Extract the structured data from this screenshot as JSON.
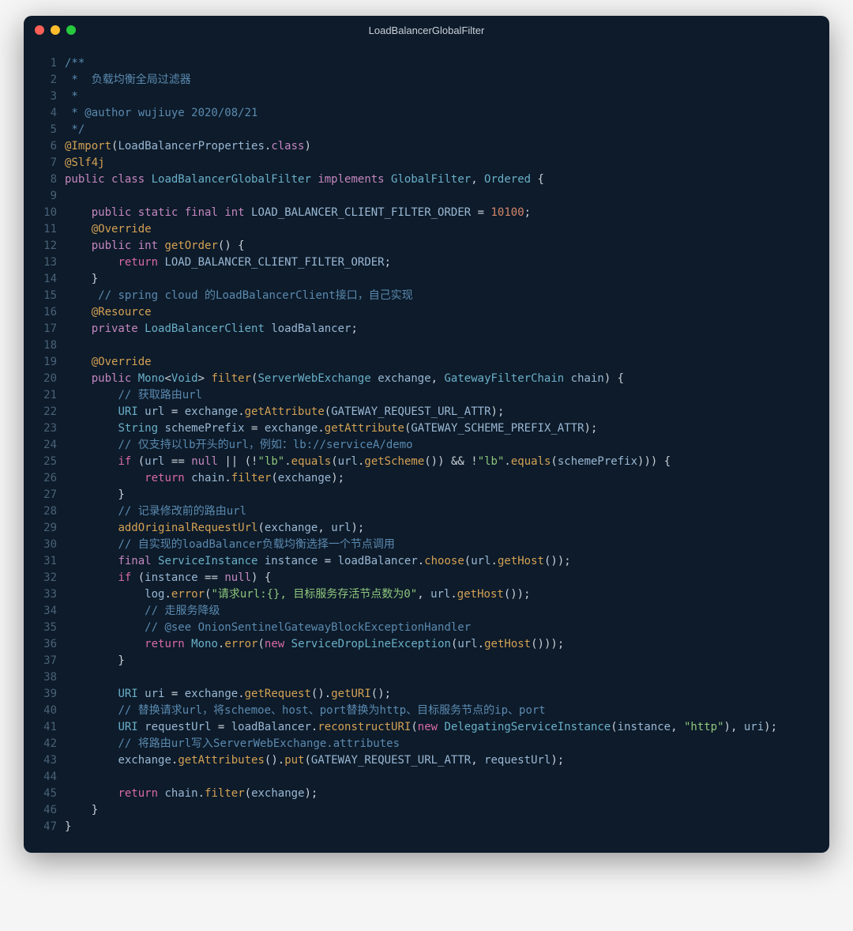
{
  "window": {
    "title": "LoadBalancerGlobalFilter"
  },
  "traffic_lights": [
    "red",
    "yellow",
    "green"
  ],
  "code": {
    "lines": [
      [
        [
          "cm",
          "/**"
        ]
      ],
      [
        [
          "cm",
          " *  负载均衡全局过滤器"
        ]
      ],
      [
        [
          "cm",
          " *"
        ]
      ],
      [
        [
          "cm",
          " * @author wujiuye 2020/08/21"
        ]
      ],
      [
        [
          "cm",
          " */"
        ]
      ],
      [
        [
          "an",
          "@Import"
        ],
        [
          "op",
          "("
        ],
        [
          "id",
          "LoadBalancerProperties"
        ],
        [
          "op",
          "."
        ],
        [
          "kw",
          "class"
        ],
        [
          "op",
          ")"
        ]
      ],
      [
        [
          "an",
          "@Slf4j"
        ]
      ],
      [
        [
          "kw",
          "public "
        ],
        [
          "kw",
          "class "
        ],
        [
          "ty",
          "LoadBalancerGlobalFilter "
        ],
        [
          "kw",
          "implements "
        ],
        [
          "ty",
          "GlobalFilter"
        ],
        [
          "op",
          ", "
        ],
        [
          "ty",
          "Ordered"
        ],
        [
          "op",
          " {"
        ]
      ],
      [],
      [
        [
          "op",
          "    "
        ],
        [
          "kw",
          "public "
        ],
        [
          "kw",
          "static "
        ],
        [
          "kw",
          "final "
        ],
        [
          "kw",
          "int "
        ],
        [
          "id",
          "LOAD_BALANCER_CLIENT_FILTER_ORDER"
        ],
        [
          "op",
          " = "
        ],
        [
          "nm",
          "10100"
        ],
        [
          "op",
          ";"
        ]
      ],
      [
        [
          "op",
          "    "
        ],
        [
          "an",
          "@Override"
        ]
      ],
      [
        [
          "op",
          "    "
        ],
        [
          "kw",
          "public "
        ],
        [
          "kw",
          "int "
        ],
        [
          "fn",
          "getOrder"
        ],
        [
          "op",
          "() {"
        ]
      ],
      [
        [
          "op",
          "        "
        ],
        [
          "kw2",
          "return "
        ],
        [
          "id",
          "LOAD_BALANCER_CLIENT_FILTER_ORDER"
        ],
        [
          "op",
          ";"
        ]
      ],
      [
        [
          "op",
          "    }"
        ]
      ],
      [
        [
          "op",
          "     "
        ],
        [
          "cm",
          "// spring cloud 的LoadBalancerClient接口，自己实现"
        ]
      ],
      [
        [
          "op",
          "    "
        ],
        [
          "an",
          "@Resource"
        ]
      ],
      [
        [
          "op",
          "    "
        ],
        [
          "kw",
          "private "
        ],
        [
          "ty",
          "LoadBalancerClient "
        ],
        [
          "id",
          "loadBalancer"
        ],
        [
          "op",
          ";"
        ]
      ],
      [],
      [
        [
          "op",
          "    "
        ],
        [
          "an",
          "@Override"
        ]
      ],
      [
        [
          "op",
          "    "
        ],
        [
          "kw",
          "public "
        ],
        [
          "ty",
          "Mono"
        ],
        [
          "op",
          "<"
        ],
        [
          "ty",
          "Void"
        ],
        [
          "op",
          "> "
        ],
        [
          "fn",
          "filter"
        ],
        [
          "op",
          "("
        ],
        [
          "ty",
          "ServerWebExchange "
        ],
        [
          "id",
          "exchange"
        ],
        [
          "op",
          ", "
        ],
        [
          "ty",
          "GatewayFilterChain "
        ],
        [
          "id",
          "chain"
        ],
        [
          "op",
          ") {"
        ]
      ],
      [
        [
          "op",
          "        "
        ],
        [
          "cm",
          "// 获取路由url"
        ]
      ],
      [
        [
          "op",
          "        "
        ],
        [
          "ty",
          "URI "
        ],
        [
          "id",
          "url"
        ],
        [
          "op",
          " = "
        ],
        [
          "id",
          "exchange"
        ],
        [
          "op",
          "."
        ],
        [
          "fn",
          "getAttribute"
        ],
        [
          "op",
          "("
        ],
        [
          "id",
          "GATEWAY_REQUEST_URL_ATTR"
        ],
        [
          "op",
          ");"
        ]
      ],
      [
        [
          "op",
          "        "
        ],
        [
          "ty",
          "String "
        ],
        [
          "id",
          "schemePrefix"
        ],
        [
          "op",
          " = "
        ],
        [
          "id",
          "exchange"
        ],
        [
          "op",
          "."
        ],
        [
          "fn",
          "getAttribute"
        ],
        [
          "op",
          "("
        ],
        [
          "id",
          "GATEWAY_SCHEME_PREFIX_ATTR"
        ],
        [
          "op",
          ");"
        ]
      ],
      [
        [
          "op",
          "        "
        ],
        [
          "cm",
          "// 仅支持以lb开头的url，例如：lb://serviceA/demo"
        ]
      ],
      [
        [
          "op",
          "        "
        ],
        [
          "kw2",
          "if "
        ],
        [
          "op",
          "("
        ],
        [
          "id",
          "url"
        ],
        [
          "op",
          " == "
        ],
        [
          "kw",
          "null"
        ],
        [
          "op",
          " || (!"
        ],
        [
          "st",
          "\"lb\""
        ],
        [
          "op",
          "."
        ],
        [
          "fn",
          "equals"
        ],
        [
          "op",
          "("
        ],
        [
          "id",
          "url"
        ],
        [
          "op",
          "."
        ],
        [
          "fn",
          "getScheme"
        ],
        [
          "op",
          "()) && !"
        ],
        [
          "st",
          "\"lb\""
        ],
        [
          "op",
          "."
        ],
        [
          "fn",
          "equals"
        ],
        [
          "op",
          "("
        ],
        [
          "id",
          "schemePrefix"
        ],
        [
          "op",
          "))) {"
        ]
      ],
      [
        [
          "op",
          "            "
        ],
        [
          "kw2",
          "return "
        ],
        [
          "id",
          "chain"
        ],
        [
          "op",
          "."
        ],
        [
          "fn",
          "filter"
        ],
        [
          "op",
          "("
        ],
        [
          "id",
          "exchange"
        ],
        [
          "op",
          ");"
        ]
      ],
      [
        [
          "op",
          "        }"
        ]
      ],
      [
        [
          "op",
          "        "
        ],
        [
          "cm",
          "// 记录修改前的路由url"
        ]
      ],
      [
        [
          "op",
          "        "
        ],
        [
          "fn",
          "addOriginalRequestUrl"
        ],
        [
          "op",
          "("
        ],
        [
          "id",
          "exchange"
        ],
        [
          "op",
          ", "
        ],
        [
          "id",
          "url"
        ],
        [
          "op",
          ");"
        ]
      ],
      [
        [
          "op",
          "        "
        ],
        [
          "cm",
          "// 自实现的loadBalancer负载均衡选择一个节点调用"
        ]
      ],
      [
        [
          "op",
          "        "
        ],
        [
          "kw",
          "final "
        ],
        [
          "ty",
          "ServiceInstance "
        ],
        [
          "id",
          "instance"
        ],
        [
          "op",
          " = "
        ],
        [
          "id",
          "loadBalancer"
        ],
        [
          "op",
          "."
        ],
        [
          "fn",
          "choose"
        ],
        [
          "op",
          "("
        ],
        [
          "id",
          "url"
        ],
        [
          "op",
          "."
        ],
        [
          "fn",
          "getHost"
        ],
        [
          "op",
          "());"
        ]
      ],
      [
        [
          "op",
          "        "
        ],
        [
          "kw2",
          "if "
        ],
        [
          "op",
          "("
        ],
        [
          "id",
          "instance"
        ],
        [
          "op",
          " == "
        ],
        [
          "kw",
          "null"
        ],
        [
          "op",
          ") {"
        ]
      ],
      [
        [
          "op",
          "            "
        ],
        [
          "id",
          "log"
        ],
        [
          "op",
          "."
        ],
        [
          "fn",
          "error"
        ],
        [
          "op",
          "("
        ],
        [
          "st",
          "\"请求url:{}, 目标服务存活节点数为0\""
        ],
        [
          "op",
          ", "
        ],
        [
          "id",
          "url"
        ],
        [
          "op",
          "."
        ],
        [
          "fn",
          "getHost"
        ],
        [
          "op",
          "());"
        ]
      ],
      [
        [
          "op",
          "            "
        ],
        [
          "cm",
          "// 走服务降级"
        ]
      ],
      [
        [
          "op",
          "            "
        ],
        [
          "cm",
          "// @see OnionSentinelGatewayBlockExceptionHandler"
        ]
      ],
      [
        [
          "op",
          "            "
        ],
        [
          "kw2",
          "return "
        ],
        [
          "ty",
          "Mono"
        ],
        [
          "op",
          "."
        ],
        [
          "fn",
          "error"
        ],
        [
          "op",
          "("
        ],
        [
          "kw2",
          "new "
        ],
        [
          "ty",
          "ServiceDropLineException"
        ],
        [
          "op",
          "("
        ],
        [
          "id",
          "url"
        ],
        [
          "op",
          "."
        ],
        [
          "fn",
          "getHost"
        ],
        [
          "op",
          "()));"
        ]
      ],
      [
        [
          "op",
          "        }"
        ]
      ],
      [],
      [
        [
          "op",
          "        "
        ],
        [
          "ty",
          "URI "
        ],
        [
          "id",
          "uri"
        ],
        [
          "op",
          " = "
        ],
        [
          "id",
          "exchange"
        ],
        [
          "op",
          "."
        ],
        [
          "fn",
          "getRequest"
        ],
        [
          "op",
          "()."
        ],
        [
          "fn",
          "getURI"
        ],
        [
          "op",
          "();"
        ]
      ],
      [
        [
          "op",
          "        "
        ],
        [
          "cm",
          "// 替换请求url，将schemoe、host、port替换为http、目标服务节点的ip、port"
        ]
      ],
      [
        [
          "op",
          "        "
        ],
        [
          "ty",
          "URI "
        ],
        [
          "id",
          "requestUrl"
        ],
        [
          "op",
          " = "
        ],
        [
          "id",
          "loadBalancer"
        ],
        [
          "op",
          "."
        ],
        [
          "fn",
          "reconstructURI"
        ],
        [
          "op",
          "("
        ],
        [
          "kw2",
          "new "
        ],
        [
          "ty",
          "DelegatingServiceInstance"
        ],
        [
          "op",
          "("
        ],
        [
          "id",
          "instance"
        ],
        [
          "op",
          ", "
        ],
        [
          "st",
          "\"http\""
        ],
        [
          "op",
          "), "
        ],
        [
          "id",
          "uri"
        ],
        [
          "op",
          ");"
        ]
      ],
      [
        [
          "op",
          "        "
        ],
        [
          "cm",
          "// 将路由url写入ServerWebExchange.attributes"
        ]
      ],
      [
        [
          "op",
          "        "
        ],
        [
          "id",
          "exchange"
        ],
        [
          "op",
          "."
        ],
        [
          "fn",
          "getAttributes"
        ],
        [
          "op",
          "()."
        ],
        [
          "fn",
          "put"
        ],
        [
          "op",
          "("
        ],
        [
          "id",
          "GATEWAY_REQUEST_URL_ATTR"
        ],
        [
          "op",
          ", "
        ],
        [
          "id",
          "requestUrl"
        ],
        [
          "op",
          ");"
        ]
      ],
      [],
      [
        [
          "op",
          "        "
        ],
        [
          "kw2",
          "return "
        ],
        [
          "id",
          "chain"
        ],
        [
          "op",
          "."
        ],
        [
          "fn",
          "filter"
        ],
        [
          "op",
          "("
        ],
        [
          "id",
          "exchange"
        ],
        [
          "op",
          ");"
        ]
      ],
      [
        [
          "op",
          "    }"
        ]
      ],
      [
        [
          "op",
          "}"
        ]
      ]
    ]
  }
}
